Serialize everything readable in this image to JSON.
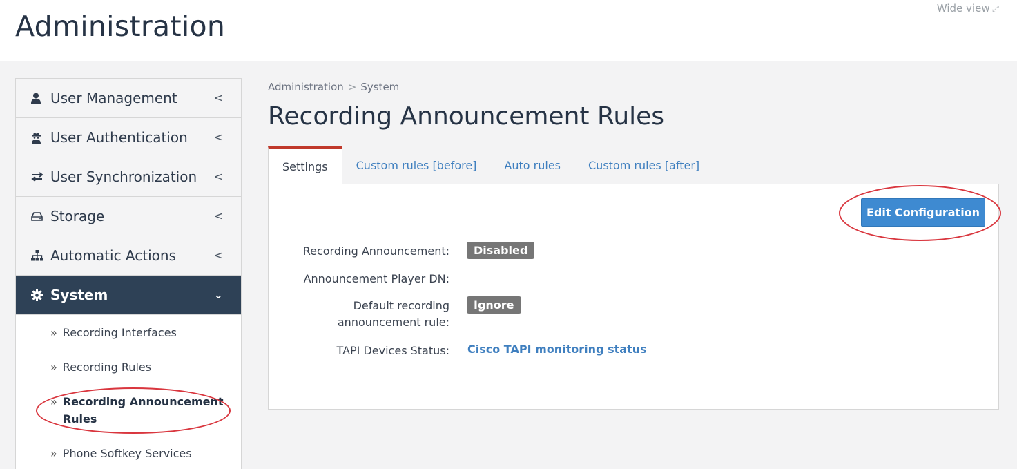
{
  "header": {
    "title": "Administration",
    "wide_view_label": "Wide view",
    "wide_view_icon": "expand-icon"
  },
  "sidebar": {
    "items": [
      {
        "label": "User Management",
        "icon": "user-icon"
      },
      {
        "label": "User Authentication",
        "icon": "user-secret-icon"
      },
      {
        "label": "User Synchronization",
        "icon": "exchange-icon"
      },
      {
        "label": "Storage",
        "icon": "hdd-icon"
      },
      {
        "label": "Automatic Actions",
        "icon": "sitemap-icon"
      },
      {
        "label": "System",
        "icon": "gear-icon",
        "active": true
      }
    ],
    "subitems": [
      {
        "label": "Recording Interfaces"
      },
      {
        "label": "Recording Rules"
      },
      {
        "label_line1": "Recording Announcement",
        "label_line2": "Rules",
        "current": true
      },
      {
        "label": "Phone Softkey Services"
      }
    ]
  },
  "breadcrumb": {
    "root": "Administration",
    "separator": ">",
    "current": "System"
  },
  "page": {
    "title": "Recording Announcement Rules"
  },
  "tabs": [
    {
      "label": "Settings",
      "active": true
    },
    {
      "label": "Custom rules [before]"
    },
    {
      "label": "Auto rules"
    },
    {
      "label": "Custom rules [after]"
    }
  ],
  "actions": {
    "edit_label": "Edit Configuration"
  },
  "fields": {
    "recording_announcement": {
      "label": "Recording Announcement:",
      "value": "Disabled"
    },
    "player_dn": {
      "label": "Announcement Player DN:",
      "value": ""
    },
    "default_rule": {
      "label_line1": "Default recording",
      "label_line2": "announcement rule:",
      "value": "Ignore"
    },
    "tapi_status": {
      "label": "TAPI Devices Status:",
      "value": "Cisco TAPI monitoring status"
    }
  },
  "colors": {
    "accent": "#3e8ad1",
    "nav_active": "#2e4156",
    "tab_active_border": "#c0392b",
    "highlight_ellipse": "#d9363e",
    "badge": "#767676",
    "link": "#3f7fbf"
  }
}
